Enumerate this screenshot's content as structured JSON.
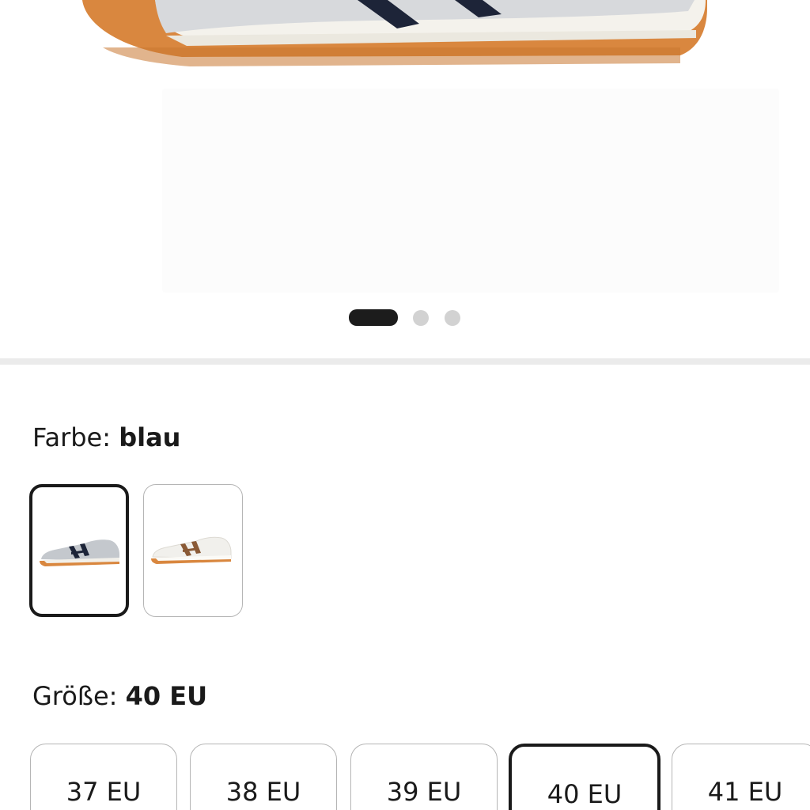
{
  "gallery": {
    "dots": [
      {
        "active": true
      },
      {
        "active": false
      },
      {
        "active": false
      }
    ]
  },
  "color": {
    "label": "Farbe:",
    "value": "blau",
    "options": [
      {
        "name": "grey-navy-sneaker",
        "selected": true
      },
      {
        "name": "white-brown-sneaker",
        "selected": false
      }
    ]
  },
  "size": {
    "label": "Größe:",
    "value": "40 EU",
    "options": [
      {
        "label": "37 EU",
        "selected": false
      },
      {
        "label": "38 EU",
        "selected": false
      },
      {
        "label": "39 EU",
        "selected": false
      },
      {
        "label": "40 EU",
        "selected": true
      },
      {
        "label": "41 EU",
        "selected": false
      }
    ]
  },
  "colors": {
    "selected_border": "#1a1a1a",
    "unselected_border": "#b5b5b5",
    "divider": "#ebebeb",
    "dot_active": "#1c1c1c",
    "dot_inactive": "#d2d2d2"
  }
}
